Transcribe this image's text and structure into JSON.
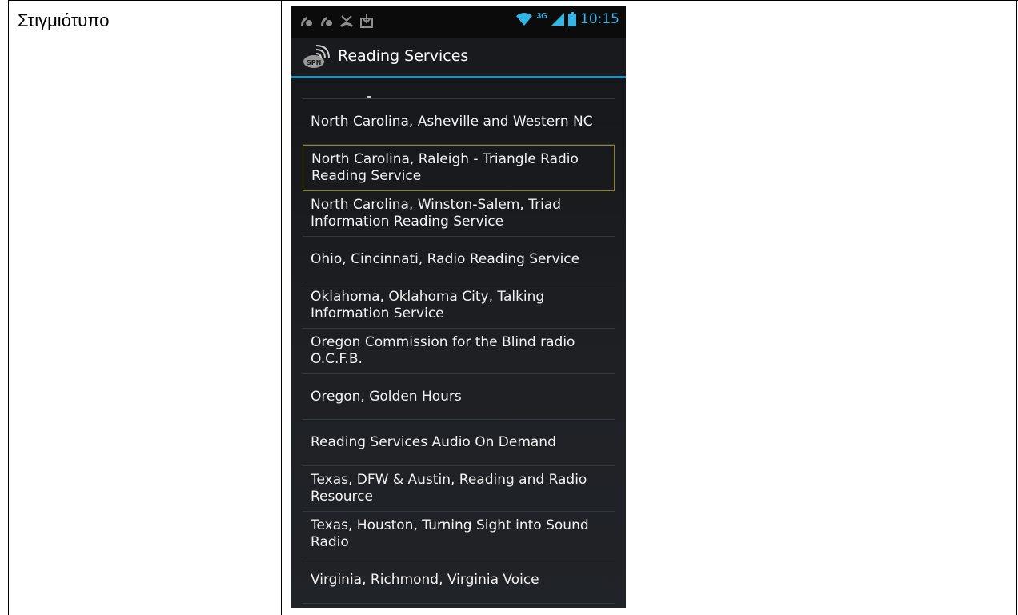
{
  "document": {
    "label": "Στιγμιότυπο"
  },
  "statusbar": {
    "time": "10:15",
    "network_type": "3G",
    "icons_left": [
      "notification-icon",
      "notification-icon",
      "missed-call-icon",
      "download-icon"
    ],
    "icons_right": [
      "wifi-icon",
      "signal-icon",
      "battery-icon"
    ]
  },
  "actionbar": {
    "title": "Reading Services",
    "icon": "spn-radio-app-icon"
  },
  "list": {
    "items": [
      {
        "label": "North Carolina, Asheville and Western NC",
        "selected": false
      },
      {
        "label": "North Carolina, Raleigh - Triangle Radio Reading Service",
        "selected": true
      },
      {
        "label": "North Carolina, Winston-Salem, Triad Information Reading Service",
        "selected": false
      },
      {
        "label": "Ohio, Cincinnati, Radio Reading Service",
        "selected": false
      },
      {
        "label": "Oklahoma, Oklahoma City, Talking Information Service",
        "selected": false
      },
      {
        "label": "Oregon Commission for the Blind radio O.C.F.B.",
        "selected": false
      },
      {
        "label": "Oregon, Golden Hours",
        "selected": false
      },
      {
        "label": "Reading Services Audio On Demand",
        "selected": false
      },
      {
        "label": "Texas, DFW & Austin, Reading and Radio Resource",
        "selected": false
      },
      {
        "label": "Texas, Houston, Turning Sight into Sound Radio",
        "selected": false
      },
      {
        "label": "Virginia, Richmond, Virginia Voice",
        "selected": false
      }
    ]
  },
  "colors": {
    "accent": "#33b5e5",
    "divider": "#1f8fbb",
    "selection": "#8b8320"
  }
}
